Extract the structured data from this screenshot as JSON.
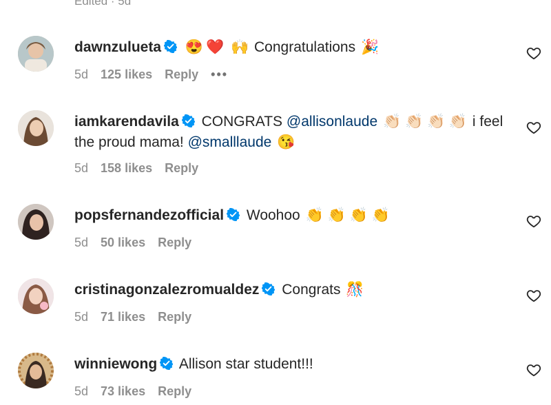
{
  "top_meta": "Edited · 5d",
  "colors": {
    "mention": "#00376b",
    "verified": "#0095f6",
    "meta": "#8e8e8e"
  },
  "comments": [
    {
      "username": "dawnzulueta",
      "verified": true,
      "text_parts": [
        "😍",
        "❤️",
        "🙌",
        "Congratulations",
        "🎉"
      ],
      "time": "5d",
      "likes": "125 likes",
      "reply": "Reply",
      "more": "•••"
    },
    {
      "username": "iamkarendavila",
      "verified": true,
      "text_a": "CONGRATS",
      "mention_1": "@allisonlaude",
      "claps": "👏🏻 👏🏻 👏🏻 👏🏻",
      "text_b": "i feel",
      "line2_text": "the proud mama!",
      "mention_2": "@smalllaude",
      "line2_emoji": "😘",
      "time": "5d",
      "likes": "158 likes",
      "reply": "Reply"
    },
    {
      "username": "popsfernandezofficial",
      "verified": true,
      "text": "Woohoo",
      "emoji": "👏 👏 👏 👏",
      "time": "5d",
      "likes": "50 likes",
      "reply": "Reply"
    },
    {
      "username": "cristinagonzalezromualdez",
      "verified": true,
      "text": "Congrats",
      "emoji": "🎊",
      "time": "5d",
      "likes": "71 likes",
      "reply": "Reply"
    },
    {
      "username": "winniewong",
      "verified": true,
      "text": "Allison star student!!!",
      "time": "5d",
      "likes": "73 likes",
      "reply": "Reply"
    }
  ]
}
